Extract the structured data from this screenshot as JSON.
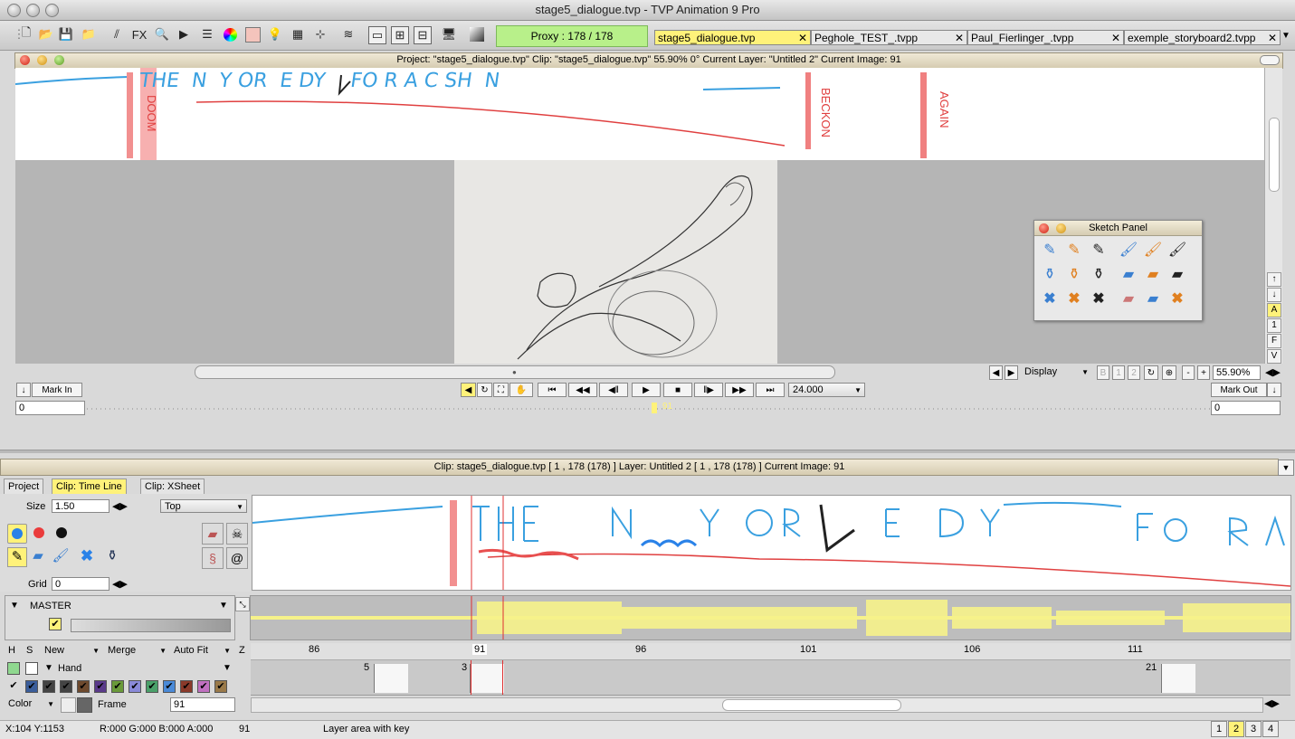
{
  "window": {
    "title": "stage5_dialogue.tvp - TVP Animation 9 Pro"
  },
  "toolbar": {
    "proxy": "Proxy : 178 / 178",
    "fx_label": "FX",
    "doc_tabs": [
      {
        "label": "stage5_dialogue.tvp",
        "active": true
      },
      {
        "label": "Peghole_TEST_.tvpp",
        "active": false
      },
      {
        "label": "Paul_Fierlinger_.tvpp",
        "active": false
      },
      {
        "label": "exemple_storyboard2.tvpp",
        "active": false
      }
    ]
  },
  "project_bar": {
    "text": "Project:  \"stage5_dialogue.tvp\"  Clip: \"stage5_dialogue.tvp\"   55.90%   0°   Current Layer: \"Untitled 2\"   Current Image: 91"
  },
  "storyboard_words": {
    "doom": "DOOM",
    "beckon": "BECKON",
    "again": "AGAIN",
    "line1": "THE  N  Y OR  E DY    FO R A C SH  N"
  },
  "side_buttons": [
    "↑",
    "↓",
    "A",
    "1",
    "F",
    "V"
  ],
  "sketch_panel": {
    "title": "Sketch Panel"
  },
  "display_bar": {
    "display": "Display",
    "b1": "B",
    "b2": "1",
    "b3": "2",
    "minus": "-",
    "plus": "+",
    "zoom": "55.90%"
  },
  "playback": {
    "mark_in": "Mark In",
    "mark_out": "Mark Out",
    "fps": "24.000",
    "in_value": "0",
    "out_value": "0",
    "marker": "91"
  },
  "clip_bar": {
    "text": "Clip: stage5_dialogue.tvp [ 1 , 178  (178) ]          Layer: Untitled 2 [ 1 , 178  (178) ]          Current Image: 91"
  },
  "tabs": [
    {
      "label": "Project",
      "active": false
    },
    {
      "label": "Clip: Time Line",
      "active": true
    },
    {
      "label": "Clip: XSheet",
      "active": false
    }
  ],
  "left_panel": {
    "size_label": "Size",
    "size_value": "1.50",
    "position": "Top",
    "grid_label": "Grid",
    "grid_value": "0"
  },
  "master": {
    "label": "MASTER"
  },
  "layer_controls": {
    "h": "H",
    "s": "S",
    "new": "New",
    "merge": "Merge",
    "auto_fit": "Auto Fit",
    "z": "Z",
    "layer_name": "Hand",
    "color": "Color",
    "frame_label": "Frame",
    "frame_value": "91"
  },
  "timeline": {
    "ruler": [
      "86",
      "91",
      "96",
      "101",
      "106",
      "111"
    ],
    "keys": [
      "5",
      "3",
      "21"
    ]
  },
  "status": {
    "coords": "X:104  Y:1153",
    "rgba": "R:000 G:000 B:000 A:000",
    "frame": "91",
    "message": "Layer area with key",
    "pages": [
      "1",
      "2",
      "3",
      "4"
    ],
    "active_page": "2"
  }
}
